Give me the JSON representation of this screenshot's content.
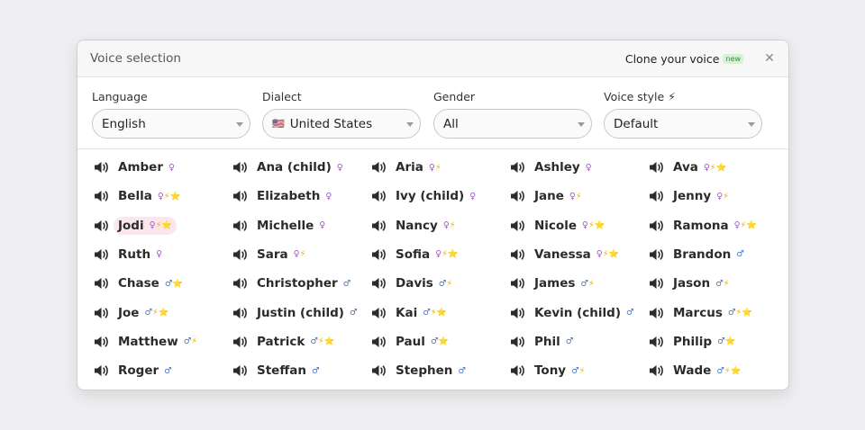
{
  "header": {
    "title": "Voice selection",
    "clone_label": "Clone your voice",
    "new_badge": "new",
    "close_glyph": "✕"
  },
  "filters": {
    "language": {
      "label": "Language",
      "value": "English"
    },
    "dialect": {
      "label": "Dialect",
      "value": "United States",
      "flag": "🇺🇸"
    },
    "gender": {
      "label": "Gender",
      "value": "All"
    },
    "style": {
      "label": "Voice style ⚡",
      "value": "Default"
    }
  },
  "voices": [
    {
      "name": "Amber",
      "tags": "♀",
      "gender": "female"
    },
    {
      "name": "Ana (child)",
      "tags": "♀",
      "gender": "female"
    },
    {
      "name": "Aria",
      "tags": "♀⚡",
      "gender": "female"
    },
    {
      "name": "Ashley",
      "tags": "♀",
      "gender": "female"
    },
    {
      "name": "Ava",
      "tags": "♀⚡⭐",
      "gender": "female"
    },
    {
      "name": "Bella",
      "tags": "♀⚡⭐",
      "gender": "female"
    },
    {
      "name": "Elizabeth",
      "tags": "♀",
      "gender": "female"
    },
    {
      "name": "Ivy (child)",
      "tags": "♀",
      "gender": "female"
    },
    {
      "name": "Jane",
      "tags": "♀⚡",
      "gender": "female"
    },
    {
      "name": "Jenny",
      "tags": "♀⚡",
      "gender": "female"
    },
    {
      "name": "Jodi",
      "tags": "♀⚡⭐",
      "gender": "female",
      "selected": true
    },
    {
      "name": "Michelle",
      "tags": "♀",
      "gender": "female"
    },
    {
      "name": "Nancy",
      "tags": "♀⚡",
      "gender": "female"
    },
    {
      "name": "Nicole",
      "tags": "♀⚡⭐",
      "gender": "female"
    },
    {
      "name": "Ramona",
      "tags": "♀⚡⭐",
      "gender": "female"
    },
    {
      "name": "Ruth",
      "tags": "♀",
      "gender": "female"
    },
    {
      "name": "Sara",
      "tags": "♀⚡",
      "gender": "female"
    },
    {
      "name": "Sofia",
      "tags": "♀⚡⭐",
      "gender": "female"
    },
    {
      "name": "Vanessa",
      "tags": "♀⚡⭐",
      "gender": "female"
    },
    {
      "name": "Brandon",
      "tags": "♂",
      "gender": "male"
    },
    {
      "name": "Chase",
      "tags": "♂⭐",
      "gender": "male"
    },
    {
      "name": "Christopher",
      "tags": "♂",
      "gender": "male"
    },
    {
      "name": "Davis",
      "tags": "♂⚡",
      "gender": "male"
    },
    {
      "name": "James",
      "tags": "♂⚡",
      "gender": "male"
    },
    {
      "name": "Jason",
      "tags": "♂⚡",
      "gender": "male"
    },
    {
      "name": "Joe",
      "tags": "♂⚡⭐",
      "gender": "male"
    },
    {
      "name": "Justin (child)",
      "tags": "♂",
      "gender": "male"
    },
    {
      "name": "Kai",
      "tags": "♂⚡⭐",
      "gender": "male"
    },
    {
      "name": "Kevin (child)",
      "tags": "♂",
      "gender": "male"
    },
    {
      "name": "Marcus",
      "tags": "♂⚡⭐",
      "gender": "male"
    },
    {
      "name": "Matthew",
      "tags": "♂⚡",
      "gender": "male"
    },
    {
      "name": "Patrick",
      "tags": "♂⚡⭐",
      "gender": "male"
    },
    {
      "name": "Paul",
      "tags": "♂⭐",
      "gender": "male"
    },
    {
      "name": "Phil",
      "tags": "♂",
      "gender": "male"
    },
    {
      "name": "Philip",
      "tags": "♂⭐",
      "gender": "male"
    },
    {
      "name": "Roger",
      "tags": "♂",
      "gender": "male"
    },
    {
      "name": "Steffan",
      "tags": "♂",
      "gender": "male"
    },
    {
      "name": "Stephen",
      "tags": "♂",
      "gender": "male"
    },
    {
      "name": "Tony",
      "tags": "♂⚡",
      "gender": "male"
    },
    {
      "name": "Wade",
      "tags": "♂⚡⭐",
      "gender": "male"
    }
  ],
  "icons": {
    "voice": "speaker-icon",
    "close": "close-icon",
    "caret": "chevron-down-icon"
  },
  "colors": {
    "female": "#9b59b6",
    "male": "#4a7ac9",
    "bolt": "#f0b400",
    "selected_bg": "#fbe6ee",
    "badge_bg": "#d8f2d8"
  }
}
